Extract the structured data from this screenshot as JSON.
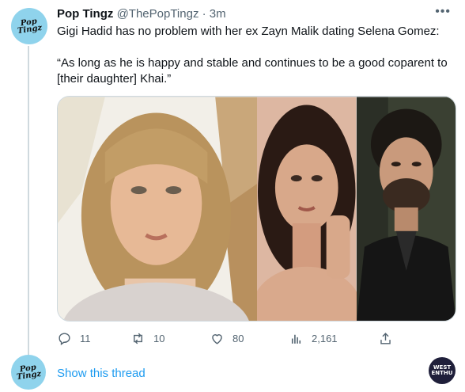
{
  "tweet": {
    "author_name": "Pop Tingz",
    "handle": "@ThePopTingz",
    "separator": "·",
    "time": "3m",
    "avatar_text": "Pop Tingz",
    "line1": "Gigi Hadid has no problem with her ex Zayn Malik dating Selena Gomez:",
    "line2": "“As long as he is happy and stable and continues to be a good coparent to [their daughter] Khai.”",
    "more_icon": "more-horizontal-icon"
  },
  "actions": {
    "reply_count": "11",
    "retweet_count": "10",
    "like_count": "80",
    "views_count": "2,161"
  },
  "thread": {
    "show_label": "Show this thread"
  },
  "watermark": {
    "line1": "WEST",
    "line2": "ENTHU"
  },
  "colors": {
    "accent": "#1d9bf0",
    "muted": "#536471",
    "avatar_bg": "#8fd3ec"
  }
}
